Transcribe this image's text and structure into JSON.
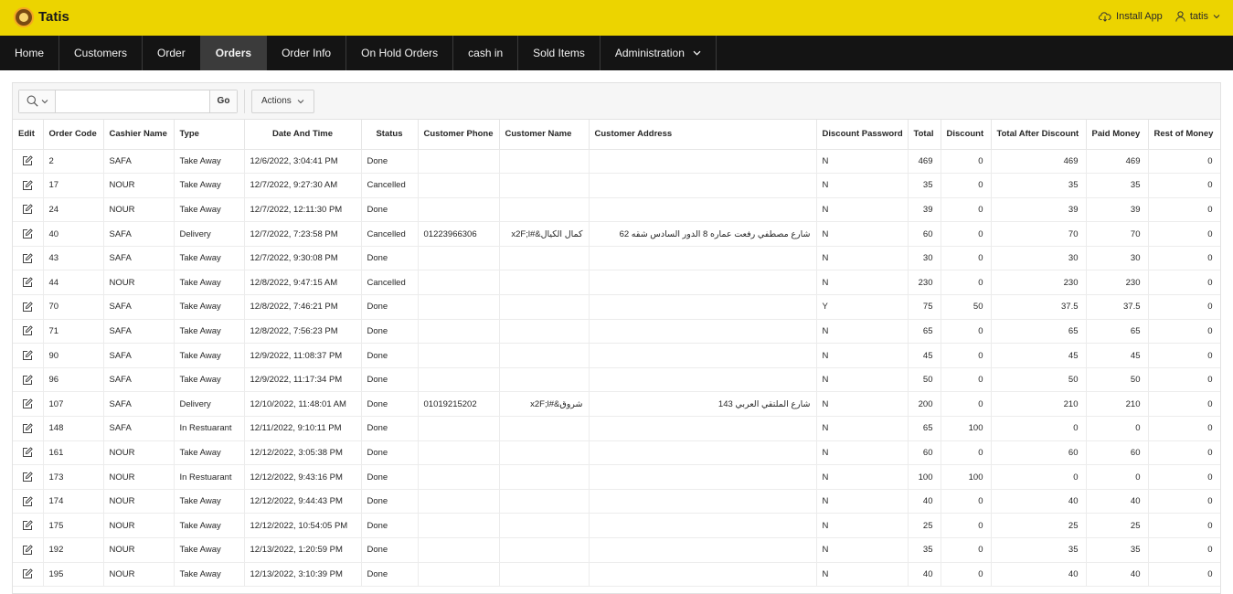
{
  "app": {
    "title": "Tatis",
    "install_label": "Install App",
    "user_label": "tatis"
  },
  "nav": {
    "items": [
      {
        "label": "Home"
      },
      {
        "label": "Customers"
      },
      {
        "label": "Order"
      },
      {
        "label": "Orders"
      },
      {
        "label": "Order Info"
      },
      {
        "label": "On Hold Orders"
      },
      {
        "label": "cash in"
      },
      {
        "label": "Sold Items"
      },
      {
        "label": "Administration"
      }
    ],
    "active": "Orders"
  },
  "toolbar": {
    "search_value": "",
    "go_label": "Go",
    "actions_label": "Actions"
  },
  "table": {
    "columns": [
      "Edit",
      "Order Code",
      "Cashier Name",
      "Type",
      "Date And Time",
      "Status",
      "Customer Phone",
      "Customer Name",
      "Customer Address",
      "Discount Password",
      "Total",
      "Discount",
      "Total After Discount",
      "Paid Money",
      "Rest of Money"
    ],
    "rows": [
      [
        "2",
        "SAFA",
        "Take Away",
        "12/6/2022, 3:04:41 PM",
        "Done",
        "",
        "",
        "",
        "N",
        "469",
        "0",
        "469",
        "469",
        "0"
      ],
      [
        "17",
        "NOUR",
        "Take Away",
        "12/7/2022, 9:27:30 AM",
        "Cancelled",
        "",
        "",
        "",
        "N",
        "35",
        "0",
        "35",
        "35",
        "0"
      ],
      [
        "24",
        "NOUR",
        "Take Away",
        "12/7/2022, 12:11:30 PM",
        "Done",
        "",
        "",
        "",
        "N",
        "39",
        "0",
        "39",
        "39",
        "0"
      ],
      [
        "40",
        "SAFA",
        "Delivery",
        "12/7/2022, 7:23:58 PM",
        "Cancelled",
        "01223966306",
        "كمال الكيال&#x2F;l",
        "شارع مصطفي رفعت عماره 8 الدور السادس شقه 62",
        "N",
        "60",
        "0",
        "70",
        "70",
        "0"
      ],
      [
        "43",
        "SAFA",
        "Take Away",
        "12/7/2022, 9:30:08 PM",
        "Done",
        "",
        "",
        "",
        "N",
        "30",
        "0",
        "30",
        "30",
        "0"
      ],
      [
        "44",
        "NOUR",
        "Take Away",
        "12/8/2022, 9:47:15 AM",
        "Cancelled",
        "",
        "",
        "",
        "N",
        "230",
        "0",
        "230",
        "230",
        "0"
      ],
      [
        "70",
        "SAFA",
        "Take Away",
        "12/8/2022, 7:46:21 PM",
        "Done",
        "",
        "",
        "",
        "Y",
        "75",
        "50",
        "37.5",
        "37.5",
        "0"
      ],
      [
        "71",
        "SAFA",
        "Take Away",
        "12/8/2022, 7:56:23 PM",
        "Done",
        "",
        "",
        "",
        "N",
        "65",
        "0",
        "65",
        "65",
        "0"
      ],
      [
        "90",
        "SAFA",
        "Take Away",
        "12/9/2022, 11:08:37 PM",
        "Done",
        "",
        "",
        "",
        "N",
        "45",
        "0",
        "45",
        "45",
        "0"
      ],
      [
        "96",
        "SAFA",
        "Take Away",
        "12/9/2022, 11:17:34 PM",
        "Done",
        "",
        "",
        "",
        "N",
        "50",
        "0",
        "50",
        "50",
        "0"
      ],
      [
        "107",
        "SAFA",
        "Delivery",
        "12/10/2022, 11:48:01 AM",
        "Done",
        "01019215202",
        "شروق&#x2F;l",
        "شارع الملتقي العربي 143",
        "N",
        "200",
        "0",
        "210",
        "210",
        "0"
      ],
      [
        "148",
        "SAFA",
        "In Restuarant",
        "12/11/2022, 9:10:11 PM",
        "Done",
        "",
        "",
        "",
        "N",
        "65",
        "100",
        "0",
        "0",
        "0"
      ],
      [
        "161",
        "NOUR",
        "Take Away",
        "12/12/2022, 3:05:38 PM",
        "Done",
        "",
        "",
        "",
        "N",
        "60",
        "0",
        "60",
        "60",
        "0"
      ],
      [
        "173",
        "NOUR",
        "In Restuarant",
        "12/12/2022, 9:43:16 PM",
        "Done",
        "",
        "",
        "",
        "N",
        "100",
        "100",
        "0",
        "0",
        "0"
      ],
      [
        "174",
        "NOUR",
        "Take Away",
        "12/12/2022, 9:44:43 PM",
        "Done",
        "",
        "",
        "",
        "N",
        "40",
        "0",
        "40",
        "40",
        "0"
      ],
      [
        "175",
        "NOUR",
        "Take Away",
        "12/12/2022, 10:54:05 PM",
        "Done",
        "",
        "",
        "",
        "N",
        "25",
        "0",
        "25",
        "25",
        "0"
      ],
      [
        "192",
        "NOUR",
        "Take Away",
        "12/13/2022, 1:20:59 PM",
        "Done",
        "",
        "",
        "",
        "N",
        "35",
        "0",
        "35",
        "35",
        "0"
      ],
      [
        "195",
        "NOUR",
        "Take Away",
        "12/13/2022, 3:10:39 PM",
        "Done",
        "",
        "",
        "",
        "N",
        "40",
        "0",
        "40",
        "40",
        "0"
      ]
    ]
  },
  "colors": {
    "header_yellow": "#ecd400",
    "nav_dark": "#141414",
    "nav_active": "#3b3b3b"
  }
}
